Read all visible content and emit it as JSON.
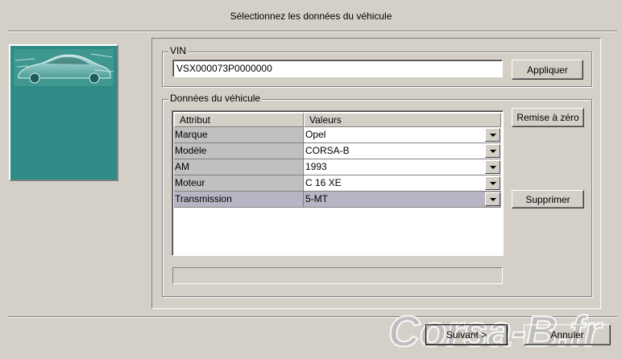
{
  "dialog": {
    "title": "Sélectionnez les données du véhicule"
  },
  "vin_group": {
    "legend": "VIN",
    "value": "VSX000073P0000000",
    "apply_label": "Appliquer"
  },
  "vehicle_group": {
    "legend": "Données du véhicule",
    "columns": [
      "Attribut",
      "Valeurs"
    ],
    "rows": [
      {
        "attribute": "Marque",
        "value": "Opel"
      },
      {
        "attribute": "Modèle",
        "value": "CORSA-B"
      },
      {
        "attribute": "AM",
        "value": "1993"
      },
      {
        "attribute": "Moteur",
        "value": "C 16 XE"
      },
      {
        "attribute": "Transmission",
        "value": "5-MT",
        "selected": true
      }
    ],
    "reset_label": "Remise à zéro",
    "delete_label": "Supprimer"
  },
  "footer": {
    "next_label": "Suivant >",
    "cancel_label": "Annuler"
  },
  "watermark": {
    "text": "Corsa-B.fr"
  },
  "colors": {
    "face": "#d4d0c8",
    "picture_bg": "#2f8b86",
    "selected_row": "#b8b4c4"
  }
}
